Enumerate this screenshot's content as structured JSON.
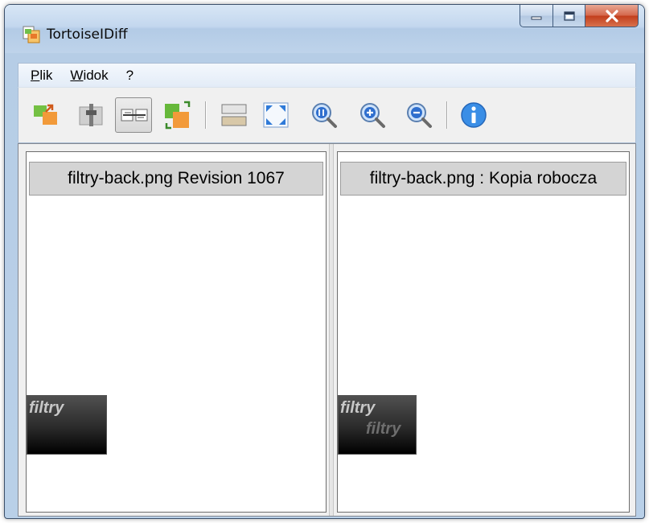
{
  "window": {
    "title": "TortoiseIDiff"
  },
  "menu": {
    "items": [
      {
        "label_acc": "P",
        "label_rest": "lik"
      },
      {
        "label_acc": "W",
        "label_rest": "idok"
      },
      {
        "label_acc": "",
        "label_rest": "?"
      }
    ]
  },
  "toolbar": {
    "icons": [
      "overlap-images-icon",
      "blend-alpha-icon",
      "link-images-icon",
      "fit-images-together-icon",
      "vertical-layout-icon",
      "fit-to-window-icon",
      "zoom-original-icon",
      "zoom-in-icon",
      "zoom-out-icon",
      "image-info-icon"
    ],
    "active": "link-images-icon"
  },
  "panes": {
    "left": {
      "header": "filtry-back.png Revision 1067",
      "thumb_text": "filtry"
    },
    "right": {
      "header": "filtry-back.png : Kopia robocza",
      "thumb_text": "filtry",
      "thumb_text2": "filtry"
    }
  },
  "colors": {
    "title_bar": "#c3d7ee",
    "close_button": "#c94a2c",
    "pane_header_bg": "#d4d4d4"
  }
}
